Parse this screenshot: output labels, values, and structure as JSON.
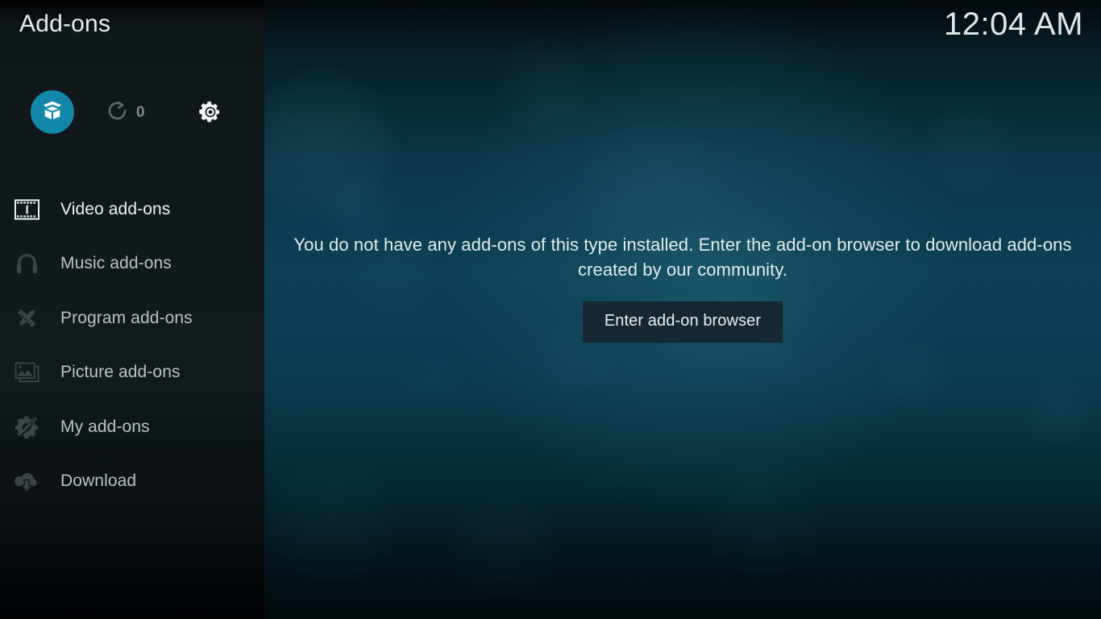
{
  "window": {
    "title": "Add-ons",
    "clock": "12:04 AM"
  },
  "colors": {
    "accent": "#1287aa",
    "sidebar_bg": "#121a1d",
    "content_bg": "#0d4055",
    "button_bg": "#142733",
    "text_primary": "#e8eef0",
    "text_dim": "#3c4448",
    "count_text": "#7f8a8d"
  },
  "topbar": {
    "addon_badge_icon": "open-box-icon",
    "refresh_icon": "refresh-icon",
    "refresh_count": "0",
    "settings_icon": "gear-icon"
  },
  "sidebar": {
    "items": [
      {
        "label": "Video add-ons",
        "icon": "film-strip-icon",
        "selected": true
      },
      {
        "label": "Music add-ons",
        "icon": "headphones-icon",
        "selected": false
      },
      {
        "label": "Program add-ons",
        "icon": "pencil-ruler-icon",
        "selected": false
      },
      {
        "label": "Picture add-ons",
        "icon": "picture-icon",
        "selected": false
      },
      {
        "label": "My add-ons",
        "icon": "gear-screwdriver-icon",
        "selected": false
      },
      {
        "label": "Download",
        "icon": "cloud-download-icon",
        "selected": false
      }
    ]
  },
  "main": {
    "empty_message": "You do not have any add-ons of this type installed. Enter the add-on browser to download add-ons created by our community.",
    "browse_button_label": "Enter add-on browser"
  }
}
